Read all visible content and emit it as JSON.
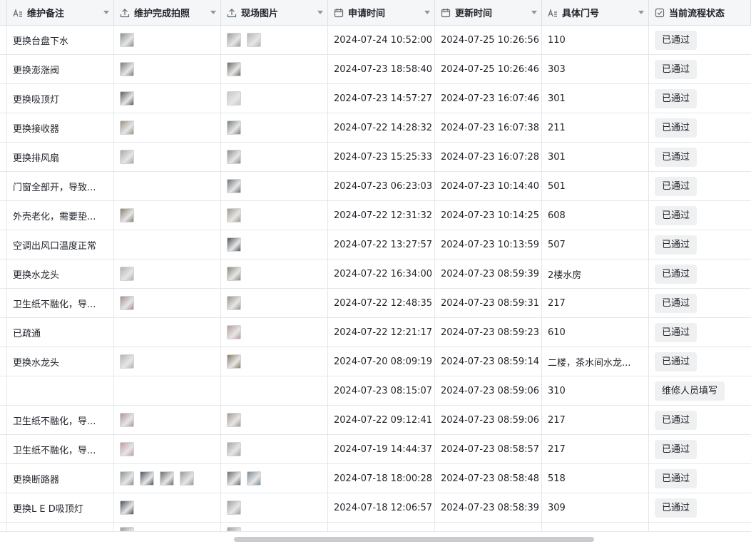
{
  "columns": [
    {
      "label": "维护备注",
      "icon": "text-field-icon"
    },
    {
      "label": "维护完成拍照",
      "icon": "upload-icon"
    },
    {
      "label": "现场图片",
      "icon": "upload-icon"
    },
    {
      "label": "申请时间",
      "icon": "calendar-icon"
    },
    {
      "label": "更新时间",
      "icon": "calendar-icon"
    },
    {
      "label": "具体门号",
      "icon": "text-field-icon"
    },
    {
      "label": "当前流程状态",
      "icon": "checkbox-icon"
    }
  ],
  "rows": [
    {
      "note": "更换台盘下水",
      "done_photos": [
        "#8a8e90"
      ],
      "site_photos": [
        "#9a9c9e",
        "#b5b5b5"
      ],
      "applied": "2024-07-24 10:52:00",
      "updated": "2024-07-25 10:26:56",
      "room": "110",
      "status": "已通过"
    },
    {
      "note": "更换澎涨阀",
      "done_photos": [
        "#7d7a72"
      ],
      "site_photos": [
        "#6e6b66"
      ],
      "applied": "2024-07-23 18:58:40",
      "updated": "2024-07-25 10:26:46",
      "room": "303",
      "status": "已通过"
    },
    {
      "note": "更换吸顶灯",
      "done_photos": [
        "#5c5c5c"
      ],
      "site_photos": [
        "#c8c8c8"
      ],
      "applied": "2024-07-23 14:57:27",
      "updated": "2024-07-23 16:07:46",
      "room": "301",
      "status": "已通过"
    },
    {
      "note": "更换接收器",
      "done_photos": [
        "#9b9080"
      ],
      "site_photos": [
        "#7a7e80"
      ],
      "applied": "2024-07-22 14:28:32",
      "updated": "2024-07-23 16:07:38",
      "room": "211",
      "status": "已通过"
    },
    {
      "note": "更换排风扇",
      "done_photos": [
        "#a8a8a8"
      ],
      "site_photos": [
        "#8e8e8e"
      ],
      "applied": "2024-07-23 15:25:33",
      "updated": "2024-07-23 16:07:28",
      "room": "301",
      "status": "已通过"
    },
    {
      "note": "门窗全部开，导致...",
      "done_photos": [],
      "site_photos": [
        "#6f7376"
      ],
      "applied": "2024-07-23 06:23:03",
      "updated": "2024-07-23 10:14:40",
      "room": "501",
      "status": "已通过"
    },
    {
      "note": "外壳老化，需要垫...",
      "done_photos": [
        "#8a8070"
      ],
      "site_photos": [
        "#a09a8c"
      ],
      "applied": "2024-07-22 12:31:32",
      "updated": "2024-07-23 10:14:25",
      "room": "608",
      "status": "已通过"
    },
    {
      "note": "空调出风口温度正常",
      "done_photos": [],
      "site_photos": [
        "#4e565c"
      ],
      "applied": "2024-07-22 13:27:57",
      "updated": "2024-07-23 10:13:59",
      "room": "507",
      "status": "已通过"
    },
    {
      "note": "更换水龙头",
      "done_photos": [
        "#b0b0b0"
      ],
      "site_photos": [
        "#8c8878"
      ],
      "applied": "2024-07-22 16:34:00",
      "updated": "2024-07-23 08:59:39",
      "room": "2楼水房",
      "status": "已通过"
    },
    {
      "note": "卫生纸不融化，导...",
      "done_photos": [
        "#a88c8c"
      ],
      "site_photos": [
        "#9a928a"
      ],
      "applied": "2024-07-22 12:48:35",
      "updated": "2024-07-23 08:59:31",
      "room": "217",
      "status": "已通过"
    },
    {
      "note": "已疏通",
      "done_photos": [],
      "site_photos": [
        "#b89a9a"
      ],
      "applied": "2024-07-22 12:21:17",
      "updated": "2024-07-23 08:59:23",
      "room": "610",
      "status": "已通过"
    },
    {
      "note": "更换水龙头",
      "done_photos": [
        "#b4b4b4"
      ],
      "site_photos": [
        "#8a7a66"
      ],
      "applied": "2024-07-20 08:09:19",
      "updated": "2024-07-23 08:59:14",
      "room": "二楼，茶水间水龙...",
      "status": "已通过"
    },
    {
      "note": "",
      "done_photos": [],
      "site_photos": [],
      "applied": "2024-07-23 08:15:07",
      "updated": "2024-07-23 08:59:06",
      "room": "310",
      "status": "维修人员填写"
    },
    {
      "note": "卫生纸不融化，导...",
      "done_photos": [
        "#b09494"
      ],
      "site_photos": [
        "#a6988e"
      ],
      "applied": "2024-07-22 09:12:41",
      "updated": "2024-07-23 08:59:06",
      "room": "217",
      "status": "已通过"
    },
    {
      "note": "卫生纸不融化，导...",
      "done_photos": [
        "#c49aa0"
      ],
      "site_photos": [
        "#a4a6a0"
      ],
      "applied": "2024-07-19 14:44:37",
      "updated": "2024-07-23 08:58:57",
      "room": "217",
      "status": "已通过"
    },
    {
      "note": "更换断路器",
      "done_photos": [
        "#8e9296",
        "#4c5460",
        "#6e6a66",
        "#9a9a9a"
      ],
      "site_photos": [
        "#6a6e6c",
        "#7a8c96"
      ],
      "applied": "2024-07-18 18:00:28",
      "updated": "2024-07-23 08:58:48",
      "room": "518",
      "status": "已通过"
    },
    {
      "note": "更换L E D吸顶灯",
      "done_photos": [
        "#4a5058"
      ],
      "site_photos": [
        "#a0a0a0"
      ],
      "applied": "2024-07-18 12:06:57",
      "updated": "2024-07-23 08:58:39",
      "room": "309",
      "status": "已通过"
    }
  ],
  "partial_row": {
    "done_photos": [
      "#9a9a9a"
    ],
    "site_photos": [
      "#a0a0a0"
    ]
  }
}
